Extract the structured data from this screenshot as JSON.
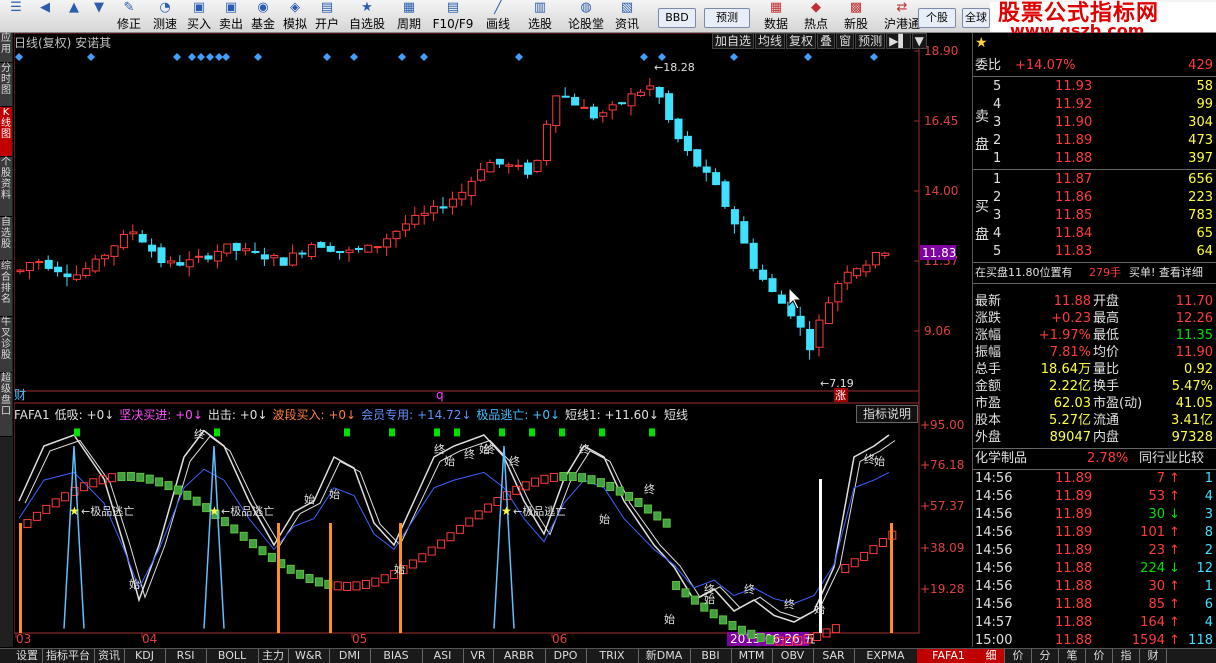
{
  "toolbar": {
    "items": [
      {
        "label": "",
        "icon": "list-icon"
      },
      {
        "label": "",
        "icon": "back-arrow-icon"
      },
      {
        "label": "",
        "icon": "up-arrow-icon"
      },
      {
        "label": "",
        "icon": "down-arrow-icon"
      },
      {
        "label": "修正",
        "icon": "wrench-icon"
      },
      {
        "label": "测速",
        "icon": "speed-icon"
      },
      {
        "label": "买入",
        "icon": "buy-icon"
      },
      {
        "label": "卖出",
        "icon": "sell-icon"
      },
      {
        "label": "基金",
        "icon": "fund-icon"
      },
      {
        "label": "模拟",
        "icon": "simulate-icon"
      },
      {
        "label": "开户",
        "icon": "account-icon"
      },
      {
        "label": "自选股",
        "icon": "watchlist-icon"
      },
      {
        "label": "周期",
        "icon": "period-icon"
      },
      {
        "label": "F10/F9",
        "icon": "f10-icon"
      },
      {
        "label": "画线",
        "icon": "draw-line-icon"
      },
      {
        "label": "选股",
        "icon": "select-stock-icon"
      },
      {
        "label": "论股堂",
        "icon": "forum-icon"
      },
      {
        "label": "资讯",
        "icon": "news-icon"
      }
    ],
    "bbd": "BBD",
    "forecast": "预测",
    "items2": [
      {
        "label": "数据",
        "icon": "data-icon"
      },
      {
        "label": "热点",
        "icon": "hot-icon"
      },
      {
        "label": "新股",
        "icon": "new-stock-icon"
      },
      {
        "label": "沪港通",
        "icon": "hk-connect-icon"
      }
    ],
    "individual": "个股",
    "full": "全球"
  },
  "logo": {
    "line1": "股票公式指标网",
    "line2": "www.gszb.com"
  },
  "left_tabs": [
    "应用",
    "分时图",
    "K线图",
    "个股资料",
    "自选股",
    "综合排名",
    "牛叉诊股",
    "超级盘口"
  ],
  "main": {
    "title": "日线(复权) 安诺其",
    "buttons": [
      "加自选",
      "均线",
      "复权",
      "叠",
      "窗",
      "预测"
    ],
    "y_axis": [
      "18.90",
      "16.45",
      "14.00",
      "11.57",
      "9.06"
    ],
    "current_price": "11.83",
    "high_label": "18.28",
    "low_label": "7.19",
    "cai": "财",
    "q": "q",
    "zhang": "涨"
  },
  "indicator": {
    "name": "FAFA1",
    "fields": [
      {
        "label": "低吸: +0",
        "color": "#e0e0e0"
      },
      {
        "label": "坚决买进: +0",
        "color": "#ff50ff"
      },
      {
        "label": "出击: +0",
        "color": "#e0e0e0"
      },
      {
        "label": "波段买入: +0",
        "color": "#ff8040"
      },
      {
        "label": "会员专用: +14.72",
        "color": "#6090ff"
      },
      {
        "label": "极品逃亡: +0",
        "color": "#40c0ff"
      },
      {
        "label": "短线1: +11.60",
        "color": "#e0e0e0"
      },
      {
        "label": "短线",
        "color": "#e0e0e0"
      }
    ],
    "explain": "指标说明",
    "y_axis": [
      "+95.00",
      "+76.18",
      "+57.37",
      "+38.09",
      "+19.28"
    ],
    "annotations": [
      "极品逃亡",
      "极品逃亡",
      "极品逃亡"
    ],
    "marker_labels": [
      "终",
      "始"
    ]
  },
  "x_axis": [
    "03",
    "04",
    "05",
    "06"
  ],
  "date_cursor": "2015-06-26,五",
  "right": {
    "wei_bi": {
      "label": "委比",
      "value": "+14.07%",
      "diff": "429"
    },
    "sell": [
      {
        "n": "5",
        "price": "11.93",
        "vol": "58"
      },
      {
        "n": "4",
        "price": "11.92",
        "vol": "99"
      },
      {
        "n": "3",
        "price": "11.90",
        "vol": "304"
      },
      {
        "n": "2",
        "price": "11.89",
        "vol": "473"
      },
      {
        "n": "1",
        "price": "11.88",
        "vol": "397"
      }
    ],
    "sell_label": [
      "卖",
      "盘"
    ],
    "buy": [
      {
        "n": "1",
        "price": "11.87",
        "vol": "656"
      },
      {
        "n": "2",
        "price": "11.86",
        "vol": "223"
      },
      {
        "n": "3",
        "price": "11.85",
        "vol": "783"
      },
      {
        "n": "4",
        "price": "11.84",
        "vol": "65"
      },
      {
        "n": "5",
        "price": "11.83",
        "vol": "64"
      }
    ],
    "buy_label": [
      "买",
      "盘"
    ],
    "notice": "在买盘11.80位置有",
    "notice_vol": "279手",
    "notice_act": "买单! 查看详细",
    "quotes": [
      {
        "l": "最新",
        "v": "11.88",
        "l2": "开盘",
        "v2": "11.70"
      },
      {
        "l": "涨跌",
        "v": "+0.23",
        "l2": "最高",
        "v2": "12.26"
      },
      {
        "l": "涨幅",
        "v": "+1.97%",
        "l2": "最低",
        "v2": "11.35"
      },
      {
        "l": "振幅",
        "v": "7.81%",
        "l2": "均价",
        "v2": "11.90"
      },
      {
        "l": "总手",
        "v": "18.64万",
        "l2": "量比",
        "v2": "0.92"
      },
      {
        "l": "金额",
        "v": "2.22亿",
        "l2": "换手",
        "v2": "5.47%"
      },
      {
        "l": "市盈",
        "v": "62.03",
        "l2": "市盈(动)",
        "v2": "41.05"
      },
      {
        "l": "股本",
        "v": "5.27亿",
        "l2": "流通",
        "v2": "3.41亿"
      },
      {
        "l": "外盘",
        "v": "89047",
        "l2": "内盘",
        "v2": "97328"
      }
    ],
    "sector": {
      "name": "化学制品",
      "pct": "2.78%",
      "compare": "同行业比较"
    },
    "ticks": [
      {
        "t": "14:56",
        "p": "11.89",
        "v": "7",
        "dir": "up",
        "n": "1"
      },
      {
        "t": "14:56",
        "p": "11.89",
        "v": "53",
        "dir": "up",
        "n": "4"
      },
      {
        "t": "14:56",
        "p": "11.89",
        "v": "30",
        "dir": "down",
        "n": "3"
      },
      {
        "t": "14:56",
        "p": "11.89",
        "v": "101",
        "dir": "up",
        "n": "8"
      },
      {
        "t": "14:56",
        "p": "11.89",
        "v": "23",
        "dir": "up",
        "n": "2"
      },
      {
        "t": "14:56",
        "p": "11.88",
        "v": "224",
        "dir": "down",
        "n": "12"
      },
      {
        "t": "14:56",
        "p": "11.88",
        "v": "30",
        "dir": "up",
        "n": "1"
      },
      {
        "t": "14:56",
        "p": "11.88",
        "v": "85",
        "dir": "up",
        "n": "6"
      },
      {
        "t": "14:57",
        "p": "11.88",
        "v": "164",
        "dir": "up",
        "n": "4"
      },
      {
        "t": "15:00",
        "p": "11.88",
        "v": "1594",
        "dir": "up",
        "n": "118"
      }
    ]
  },
  "bottom_tabs": [
    "设置",
    "指标平台",
    "资讯",
    "KDJ",
    "RSI",
    "BOLL",
    "主力",
    "W&R",
    "DMI",
    "BIAS",
    "ASI",
    "VR",
    "ARBR",
    "DPO",
    "TRIX",
    "新DMA",
    "BBI",
    "MTM",
    "OBV",
    "SAR",
    "EXPMA",
    "FAFA1"
  ],
  "bottom_right_tabs": [
    "细",
    "价",
    "分",
    "笔",
    "价",
    "指",
    "财"
  ]
}
